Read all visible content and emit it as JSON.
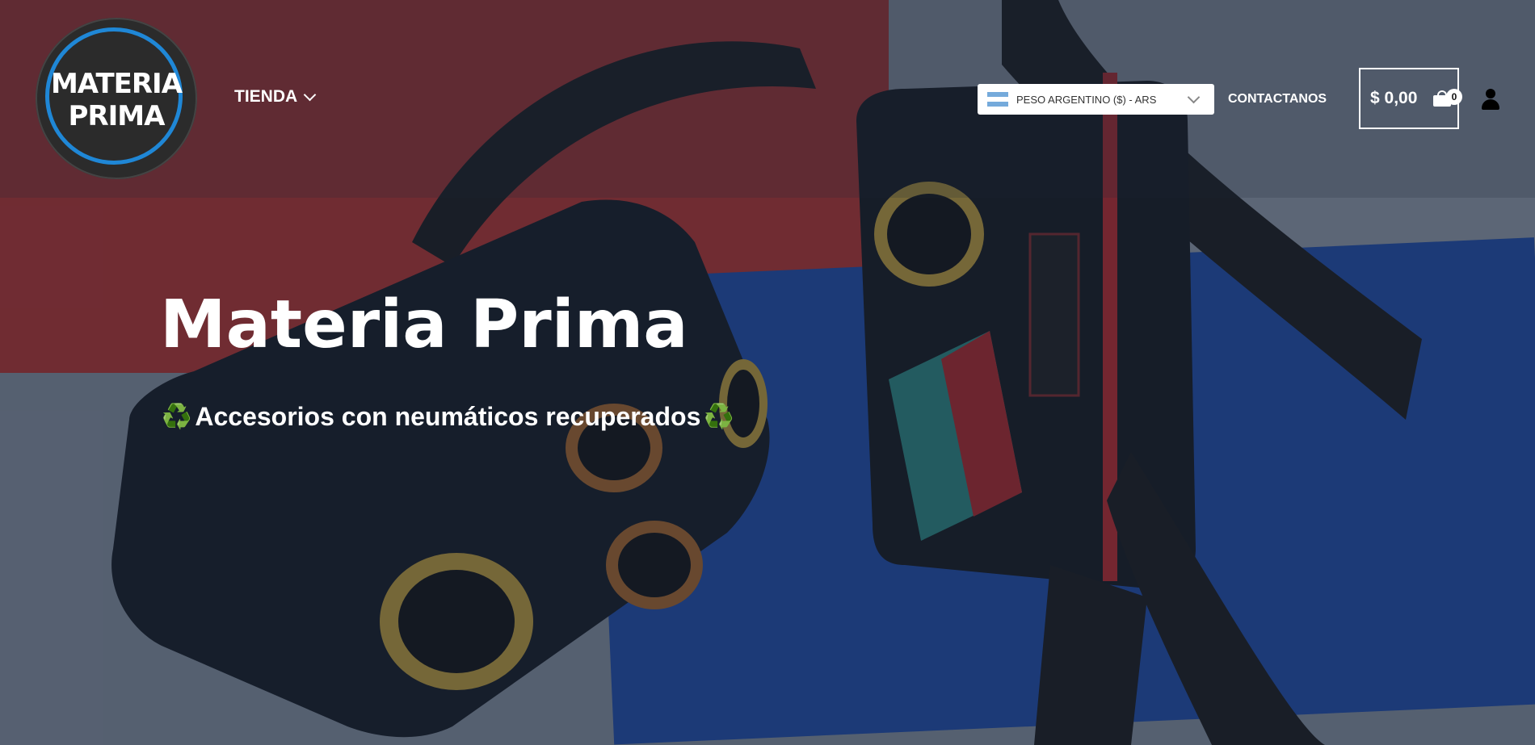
{
  "brand": {
    "logo_text_line1": "MATERIA",
    "logo_text_line2": "PRIMA",
    "logo_colors": {
      "ring": "#1f87d6",
      "fill": "#2b2b2b"
    }
  },
  "nav": {
    "tienda_label": "TIENDA",
    "contact_label": "CONTACTANOS"
  },
  "currency": {
    "selected": "PESO ARGENTINO ($) - ARS",
    "flag_icon": "argentina-flag-icon"
  },
  "cart": {
    "total": "$ 0,00",
    "count": "0",
    "icon": "shopping-bag-icon"
  },
  "account": {
    "icon": "user-icon"
  },
  "hero": {
    "title": "Materia Prima",
    "subtitle": "Accesorios con neumáticos recuperados",
    "subtitle_icon": "♻️",
    "background_colors": {
      "red": "#c0342f",
      "blue": "#1f4fb3",
      "gray": "#8d98a6"
    }
  }
}
